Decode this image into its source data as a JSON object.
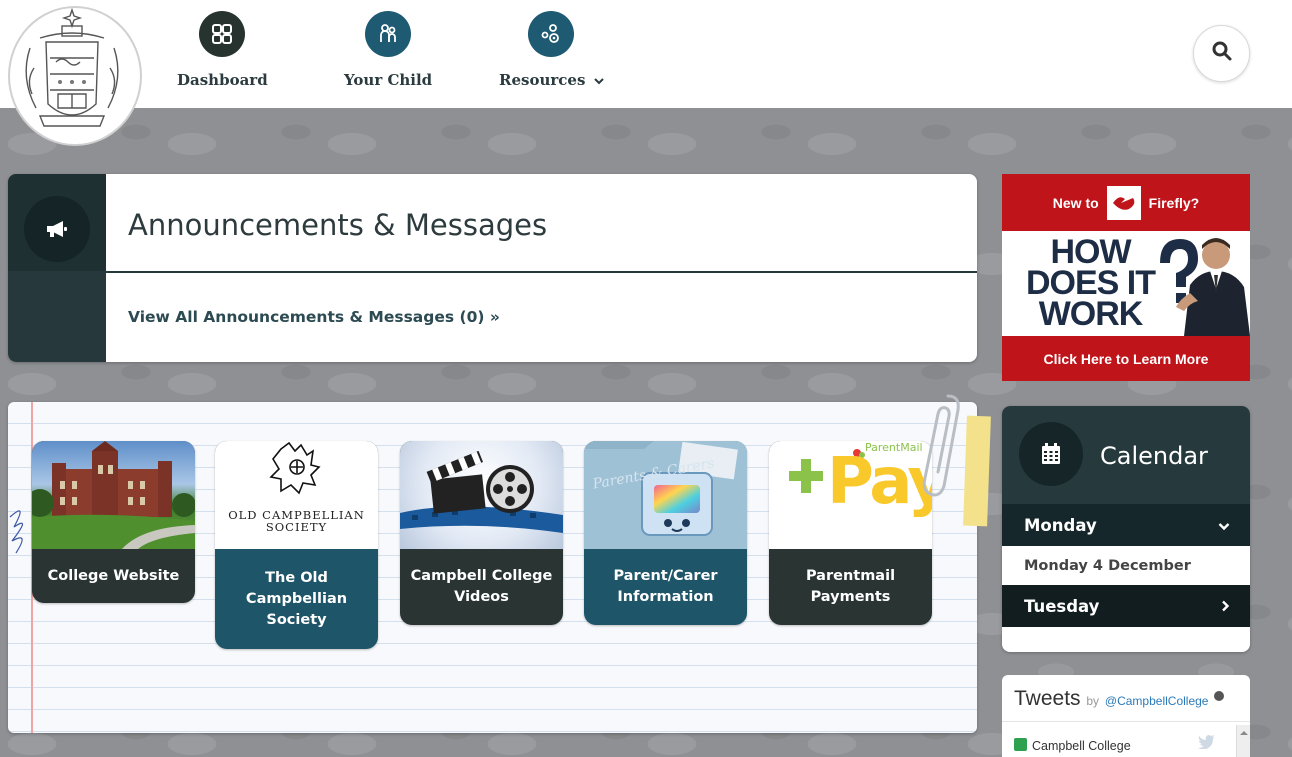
{
  "nav": {
    "items": [
      {
        "label": "Dashboard",
        "icon": "grid-icon",
        "color": "#26332f"
      },
      {
        "label": "Your Child",
        "icon": "child-icon",
        "color": "#1e5a72"
      },
      {
        "label": "Resources",
        "icon": "resources-icon",
        "color": "#1e5a72",
        "has_dropdown": true
      }
    ],
    "dropdown_glyph": "⌄"
  },
  "announcements": {
    "title": "Announcements & Messages",
    "link": "View All Announcements & Messages (0) »"
  },
  "tiles": [
    {
      "label": "College Website",
      "style": "dark"
    },
    {
      "label": "The Old Campbellian Society",
      "style": "teal",
      "image_text": "OLD CAMPBELLIAN SOCIETY"
    },
    {
      "label": "Campbell College Videos",
      "style": "dark"
    },
    {
      "label": "Parent/Carer Information",
      "style": "teal",
      "image_text": "Parents & Carers"
    },
    {
      "label": "Parentmail Payments",
      "style": "dark",
      "image_text": "Pay",
      "brand_text": "ParentMail"
    }
  ],
  "firefly": {
    "top_pre": "New to",
    "top_post": "Firefly?",
    "headline_1": "HOW",
    "headline_2": "DOES IT",
    "headline_3": "WORK",
    "cta": "Click Here to Learn More"
  },
  "calendar": {
    "title": "Calendar",
    "day1": "Monday",
    "day1_date": "Monday 4 December",
    "day2": "Tuesday",
    "chevron_down": "⌄",
    "chevron_right": "›"
  },
  "tweets": {
    "title": "Tweets",
    "by": "by",
    "handle": "@CampbellCollege",
    "first_name": "Campbell College"
  },
  "colors": {
    "dark_teal": "#26383b",
    "teal": "#1e5569",
    "firefly_red": "#c0141b"
  }
}
